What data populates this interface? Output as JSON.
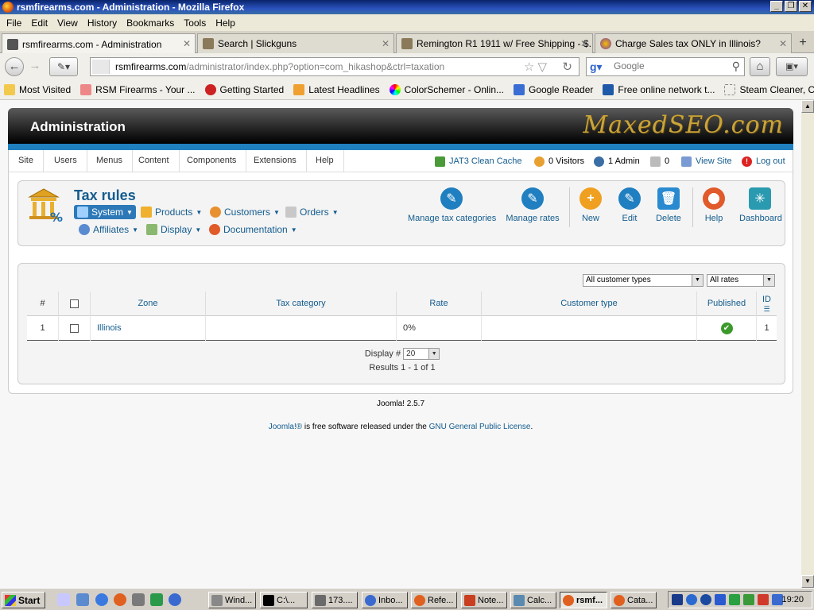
{
  "window": {
    "title": "rsmfirearms.com - Administration - Mozilla Firefox"
  },
  "menubar": [
    "File",
    "Edit",
    "View",
    "History",
    "Bookmarks",
    "Tools",
    "Help"
  ],
  "tabs": [
    {
      "label": "rsmfirearms.com - Administration",
      "active": true
    },
    {
      "label": "Search | Slickguns"
    },
    {
      "label": "Remington R1 1911 w/ Free Shipping - $..."
    },
    {
      "label": "Charge Sales tax ONLY in Illinois?"
    }
  ],
  "nav": {
    "url_domain": "rsmfirearms.com",
    "url_path": "/administrator/index.php?option=com_hikashop&ctrl=taxation",
    "search_placeholder": "Google"
  },
  "bookmarks": [
    "Most Visited",
    "RSM Firearms - Your ...",
    "Getting Started",
    "Latest Headlines",
    "ColorSchemer - Onlin...",
    "Google Reader",
    "Free online network t...",
    "Steam Cleaner, Com..."
  ],
  "admin": {
    "header_title": "Administration",
    "logo_text": "MaxedSEO.com",
    "topnav": [
      "Site",
      "Users",
      "Menus",
      "Content",
      "Components",
      "Extensions",
      "Help"
    ],
    "status": {
      "cache": "JAT3 Clean Cache",
      "visitors": "0 Visitors",
      "admins": "1 Admin",
      "messages": "0",
      "view_site": "View Site",
      "logout": "Log out"
    }
  },
  "toolbar": {
    "page_title": "Tax rules",
    "submenu": [
      "System",
      "Products",
      "Customers",
      "Orders",
      "Affiliates",
      "Display",
      "Documentation"
    ],
    "buttons": [
      "Manage tax categories",
      "Manage rates",
      "New",
      "Edit",
      "Delete",
      "Help",
      "Dashboard"
    ]
  },
  "filters": {
    "customer_type": "All customer types",
    "rates": "All rates"
  },
  "table": {
    "headers": [
      "#",
      "",
      "Zone",
      "Tax category",
      "Rate",
      "Customer type",
      "Published",
      "ID"
    ],
    "rows": [
      {
        "num": "1",
        "zone": "Illinois",
        "tax_category": "",
        "rate": "0%",
        "customer_type": "",
        "published": true,
        "id": "1"
      }
    ]
  },
  "pagination": {
    "display_label": "Display #",
    "display_value": "20",
    "results": "Results 1 - 1 of 1"
  },
  "footer": {
    "version": "Joomla! 2.5.7",
    "license_prefix": "Joomla!®",
    "license_mid": " is free software released under the ",
    "license_link": "GNU General Public License",
    "license_end": "."
  },
  "taskbar": {
    "start": "Start",
    "tasks": [
      "Wind...",
      "C:\\...",
      "173....",
      "Inbo...",
      "Refe...",
      "Note...",
      "Calc...",
      "rsmf...",
      "Cata..."
    ],
    "active_index": 7,
    "clock": "19:20"
  },
  "colors": {
    "accent": "#135c8e",
    "header_bar": "#1f7fbf",
    "published": "#3a9a2a"
  }
}
